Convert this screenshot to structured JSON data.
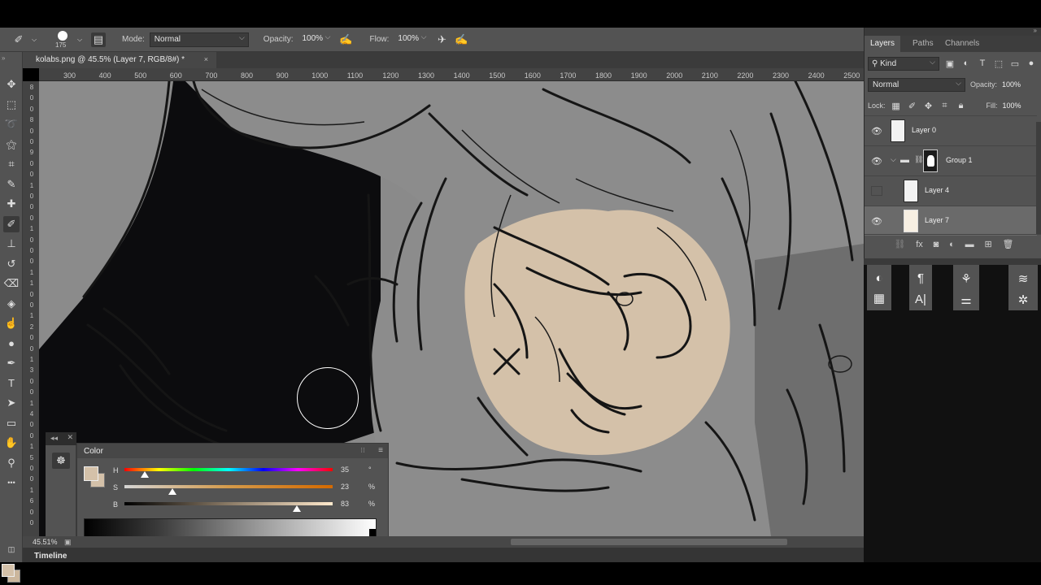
{
  "options_bar": {
    "brush_size": "175",
    "mode_label": "Mode:",
    "mode_value": "Normal",
    "opacity_label": "Opacity:",
    "opacity_value": "100%",
    "flow_label": "Flow:",
    "flow_value": "100%"
  },
  "document_tab": {
    "title": "kolabs.png @ 45.5% (Layer 7, RGB/8#) *",
    "close": "×"
  },
  "ruler_h": [
    "300",
    "400",
    "500",
    "600",
    "700",
    "800",
    "900",
    "1000",
    "1100",
    "1200",
    "1300",
    "1400",
    "1500",
    "1600",
    "1700",
    "1800",
    "1900",
    "2000",
    "2100",
    "2200",
    "2300",
    "2400",
    "2500"
  ],
  "ruler_v": [
    "8",
    "0",
    "0",
    "8",
    "0",
    "0",
    "9",
    "0",
    "0",
    "1",
    "0",
    "0",
    "0",
    "1",
    "0",
    "0",
    "0",
    "1",
    "1",
    "0",
    "0",
    "1",
    "2",
    "0",
    "0",
    "1",
    "3",
    "0",
    "0",
    "1",
    "4",
    "0",
    "0",
    "1",
    "5",
    "0",
    "0",
    "1",
    "6",
    "0",
    "0"
  ],
  "tools": [
    {
      "name": "move-tool",
      "glyph": "✥"
    },
    {
      "name": "marquee-tool",
      "glyph": "⬚"
    },
    {
      "name": "lasso-tool",
      "glyph": "➰"
    },
    {
      "name": "magic-wand-tool",
      "glyph": "⚝"
    },
    {
      "name": "crop-tool",
      "glyph": "⌗"
    },
    {
      "name": "eyedropper-tool",
      "glyph": "✎"
    },
    {
      "name": "healing-brush-tool",
      "glyph": "✚"
    },
    {
      "name": "brush-tool",
      "glyph": "✐"
    },
    {
      "name": "clone-stamp-tool",
      "glyph": "⊥"
    },
    {
      "name": "history-brush-tool",
      "glyph": "↺"
    },
    {
      "name": "eraser-tool",
      "glyph": "⌫"
    },
    {
      "name": "paint-bucket-tool",
      "glyph": "◈"
    },
    {
      "name": "smudge-tool",
      "glyph": "☝"
    },
    {
      "name": "dodge-tool",
      "glyph": "●"
    },
    {
      "name": "pen-tool",
      "glyph": "✒"
    },
    {
      "name": "type-tool",
      "glyph": "T"
    },
    {
      "name": "path-selection-tool",
      "glyph": "➤"
    },
    {
      "name": "rectangle-tool",
      "glyph": "▭"
    },
    {
      "name": "hand-tool",
      "glyph": "✋"
    },
    {
      "name": "zoom-tool",
      "glyph": "⚲"
    },
    {
      "name": "more-tools",
      "glyph": "•••"
    }
  ],
  "color_panel": {
    "title": "Color",
    "h_label": "H",
    "s_label": "S",
    "b_label": "B",
    "h_value": "35",
    "s_value": "23",
    "b_value": "83",
    "h_unit": "°",
    "s_unit": "%",
    "b_unit": "%",
    "h_fraction": 0.097,
    "s_fraction": 0.23,
    "b_fraction": 0.83,
    "foreground_color": "#d4c1a9"
  },
  "status": {
    "zoom": "45.51%"
  },
  "timeline": {
    "label": "Timeline"
  },
  "layers_panel": {
    "tabs": [
      "Layers",
      "Paths",
      "Channels"
    ],
    "kind_label": "Kind",
    "blend_mode": "Normal",
    "opacity_label": "Opacity:",
    "opacity_value": "100%",
    "lock_label": "Lock:",
    "fill_label": "Fill:",
    "fill_value": "100%",
    "layers": [
      {
        "name": "Layer 0",
        "visible": true,
        "selected": false
      },
      {
        "name": "Group 1",
        "visible": true,
        "selected": false
      },
      {
        "name": "Layer 4",
        "visible": false,
        "selected": false
      },
      {
        "name": "Layer 7",
        "visible": true,
        "selected": true
      }
    ]
  },
  "colors": {
    "panel_bg": "#535353",
    "dark_bg": "#3c3c3c",
    "skin_tone": "#d4c1a9"
  }
}
